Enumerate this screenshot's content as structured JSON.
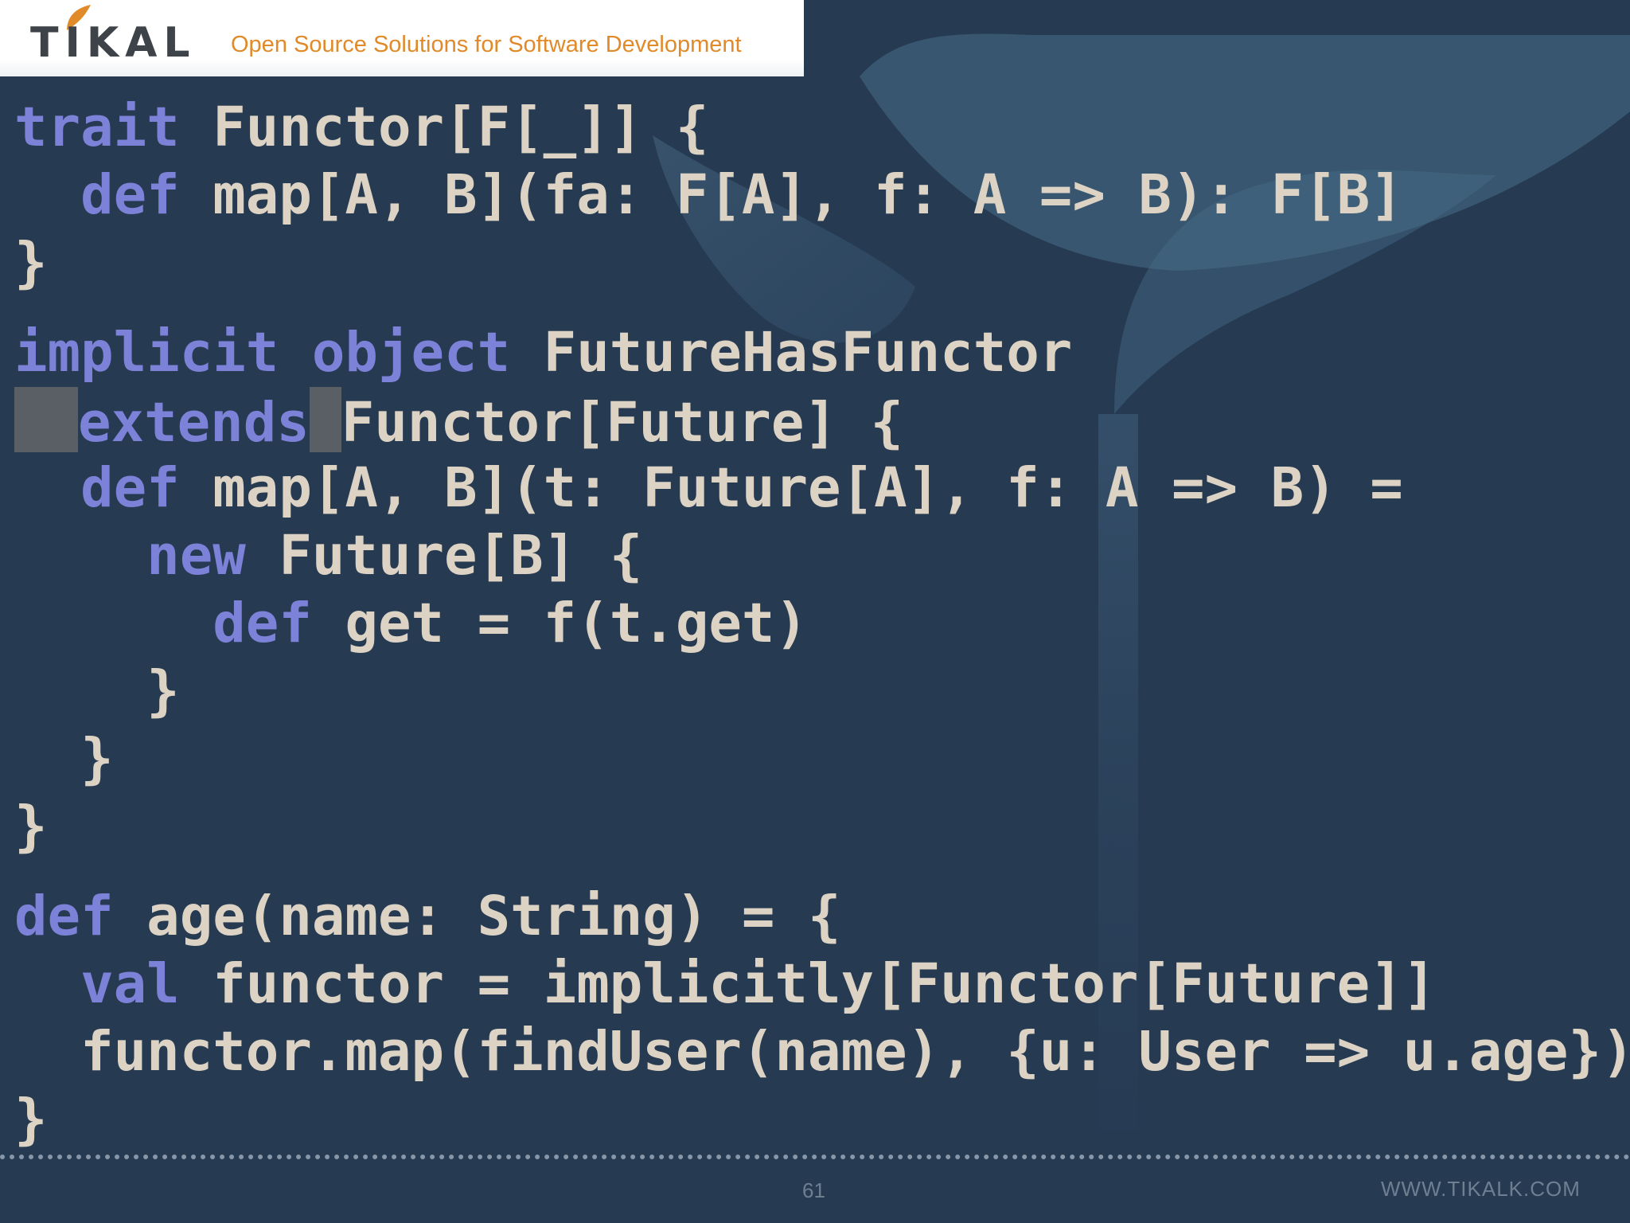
{
  "header": {
    "logo_text": "TIKAL",
    "tagline": "Open Source Solutions for Software Development"
  },
  "code": {
    "lines": [
      [
        {
          "t": "trait",
          "kw": true
        },
        {
          "t": " Functor[F[_]] {"
        }
      ],
      [
        {
          "t": "  "
        },
        {
          "t": "def",
          "kw": true
        },
        {
          "t": " map[A, B](fa: F[A], f: A => B): F[B]"
        }
      ],
      [
        {
          "t": "}"
        }
      ],
      [
        {
          "t": "implicit",
          "kw": true
        },
        {
          "t": " "
        },
        {
          "t": "object",
          "kw": true
        },
        {
          "t": " FutureHasFunctor"
        }
      ],
      [
        {
          "cursor": "a"
        },
        {
          "t": "extends",
          "kw": true
        },
        {
          "cursor": "b"
        },
        {
          "t": "Functor[Future] {"
        }
      ],
      [
        {
          "t": "  "
        },
        {
          "t": "def",
          "kw": true
        },
        {
          "t": " map[A, B](t: Future[A], f: A => B) ="
        }
      ],
      [
        {
          "t": "    "
        },
        {
          "t": "new",
          "kw": true
        },
        {
          "t": " Future[B] {"
        }
      ],
      [
        {
          "t": "      "
        },
        {
          "t": "def",
          "kw": true
        },
        {
          "t": " get = f(t.get)"
        }
      ],
      [
        {
          "t": "    }"
        }
      ],
      [
        {
          "t": "  }"
        }
      ],
      [
        {
          "t": "}"
        }
      ],
      [
        {
          "t": "def",
          "kw": true
        },
        {
          "t": " age(name: String) = {"
        }
      ],
      [
        {
          "t": "  "
        },
        {
          "t": "val",
          "kw": true
        },
        {
          "t": " functor = implicitly[Functor[Future]]"
        }
      ],
      [
        {
          "t": "  functor.map(findUser(name), {u: User => u.age})"
        }
      ],
      [
        {
          "t": "}"
        }
      ]
    ]
  },
  "footer": {
    "page_number": "61",
    "url": "WWW.TIKALK.COM"
  },
  "colors": {
    "background": "#263a52",
    "keyword": "#7c82d8",
    "code_text": "#ddd3c4",
    "tagline": "#e08a2a"
  }
}
